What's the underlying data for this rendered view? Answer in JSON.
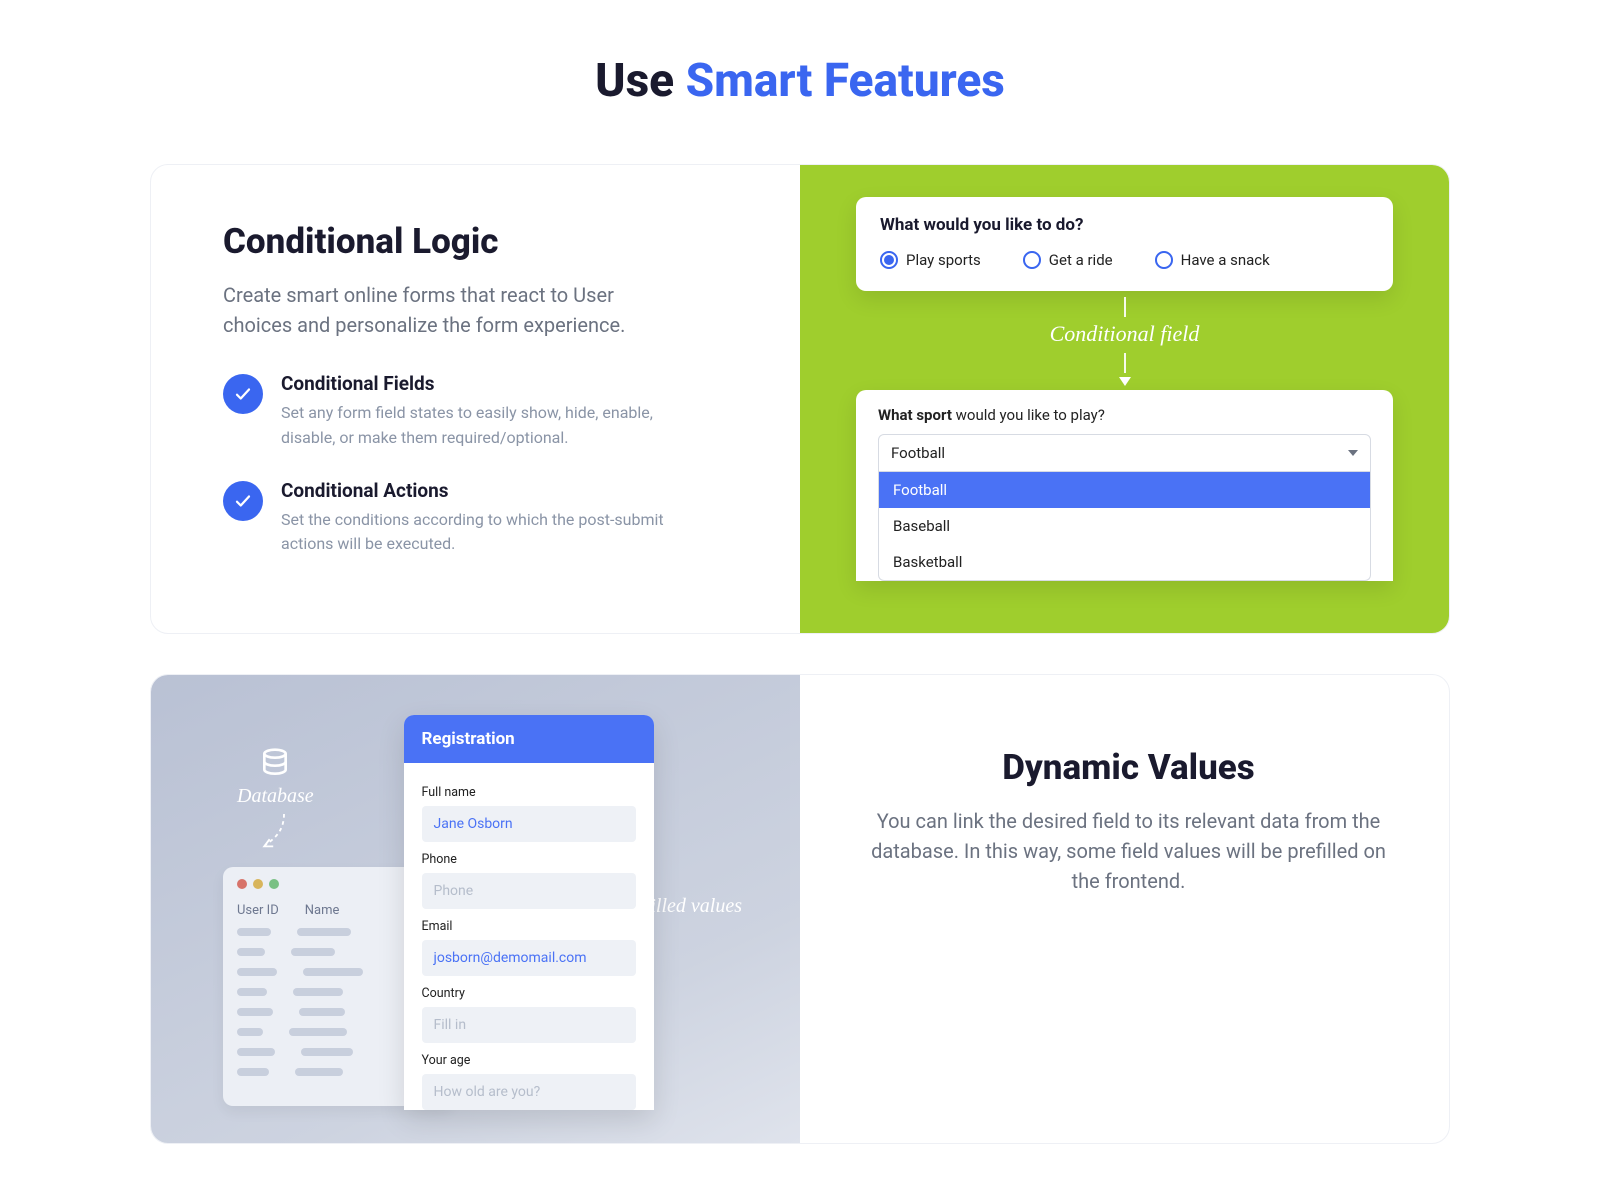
{
  "header": {
    "title_plain": "Use ",
    "title_accent": "Smart Features"
  },
  "card1": {
    "title": "Conditional Logic",
    "lead": "Create smart online forms that react to User choices and personalize the form experience.",
    "bullets": [
      {
        "title": "Conditional Fields",
        "desc": "Set any form field states to easily show, hide, enable, disable, or make them required/optional."
      },
      {
        "title": "Conditional Actions",
        "desc": "Set the conditions according to which the post-submit actions will be executed."
      }
    ],
    "visual": {
      "question1": "What would you like to do?",
      "radios": [
        {
          "label": "Play sports",
          "selected": true
        },
        {
          "label": "Get a ride",
          "selected": false
        },
        {
          "label": "Have a snack",
          "selected": false
        }
      ],
      "hand_label": "Conditional field",
      "question2_bold": "What sport",
      "question2_rest": " would you like to play?",
      "select_value": "Football",
      "options": [
        "Football",
        "Baseball",
        "Basketball"
      ]
    }
  },
  "card2": {
    "title": "Dynamic Values",
    "lead": "You can link the desired field to its relevant data from the database. In this way, some field values will be prefilled on the frontend.",
    "visual": {
      "db_label": "Database",
      "pre_label": "Pre-filled values",
      "table_headers": [
        "User ID",
        "Name"
      ],
      "reg": {
        "header": "Registration",
        "fields": [
          {
            "label": "Full name",
            "value": "Jane Osborn",
            "state": "filled"
          },
          {
            "label": "Phone",
            "value": "Phone",
            "state": "placeholder"
          },
          {
            "label": "Email",
            "value": "josborn@demomail.com",
            "state": "filled"
          },
          {
            "label": "Country",
            "value": "Fill in",
            "state": "placeholder"
          },
          {
            "label": "Your age",
            "value": "How old are you?",
            "state": "placeholder"
          }
        ]
      }
    }
  }
}
